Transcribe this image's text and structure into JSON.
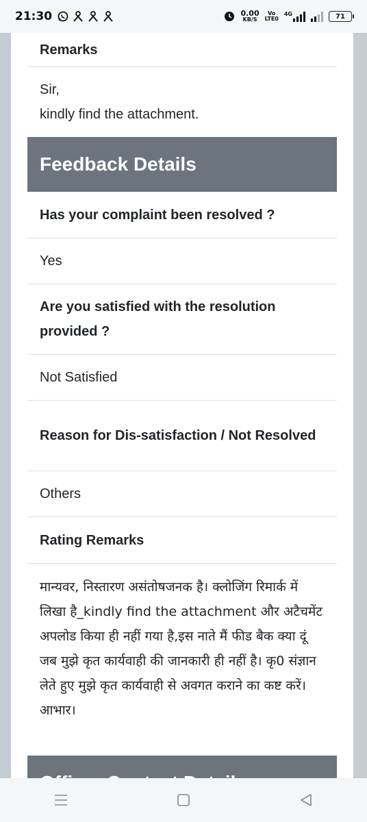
{
  "status_bar": {
    "time": "21:30",
    "net_speed_value": "0.00",
    "net_speed_unit": "KB/S",
    "volte_line1": "Vo",
    "volte_line2": "LTE0",
    "network_type": "4G",
    "battery": "71",
    "icons": [
      "whatsapp-icon",
      "person-icon",
      "person-icon",
      "person-icon",
      "alarm-icon",
      "signal-icon",
      "signal-icon",
      "battery-icon"
    ]
  },
  "remarks": {
    "label": "Remarks",
    "line1": "Sir,",
    "line2": "kindly find the attachment."
  },
  "feedback": {
    "title": "Feedback Details",
    "q1_label": "Has your complaint been resolved ?",
    "q1_value": "Yes",
    "q2_label": "Are you satisfied with the resolution provided ?",
    "q2_value": "Not Satisfied",
    "q3_label": "Reason for Dis-satisfaction / Not Resolved",
    "q3_value": "Others",
    "q4_label": "Rating Remarks",
    "q4_value": "मान्यवर, निस्तारण असंतोषजनक है। क्लोजिंग रिमार्क में लिखा है_kindly find the attachment और अटैचमेंट अपलोड किया ही नहीं गया है,इस नाते मैं फीड बैक क्या दूं जब मुझे कृत कार्यवाही की जानकारी ही नहीं है। कृ0 संज्ञान लेते हुए मुझे कृत कार्यवाही से अवगत कराने का कष्ट करें। आभार।"
  },
  "next_section": {
    "title": "Officer Contact Details"
  },
  "nav": {
    "icons": [
      "menu-icon",
      "home-icon",
      "back-icon"
    ]
  }
}
